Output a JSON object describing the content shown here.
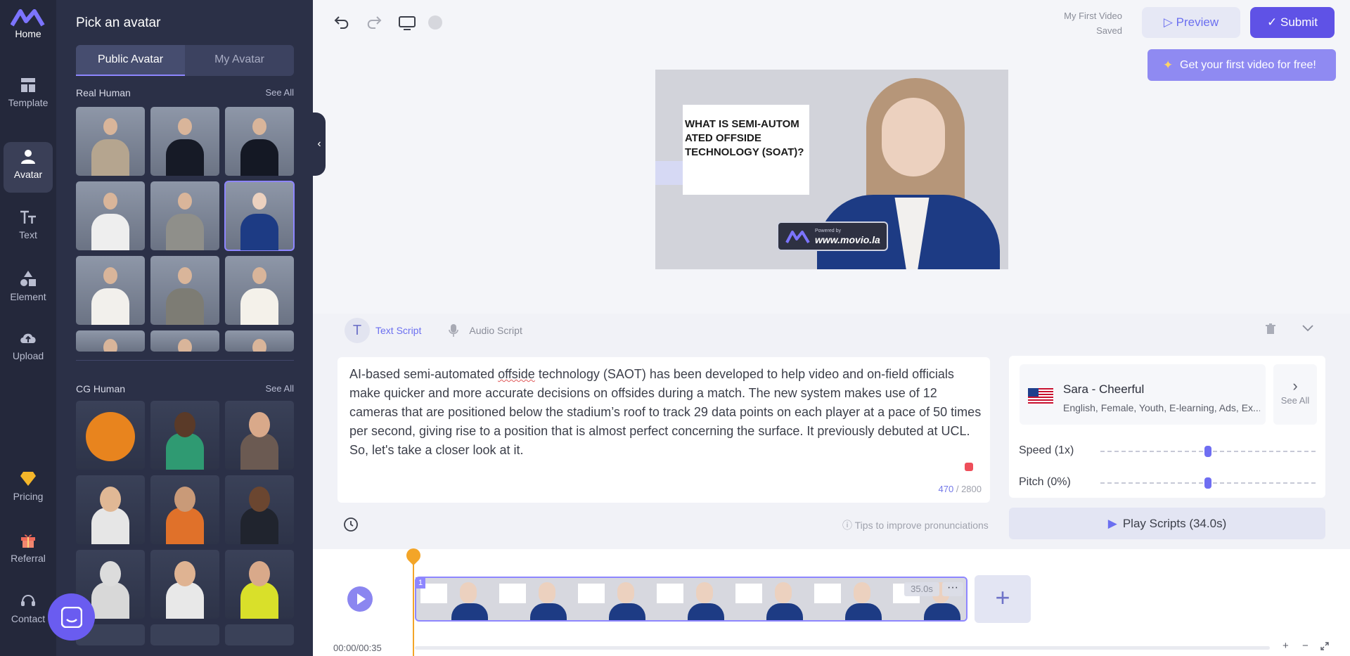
{
  "nav": {
    "home": "Home",
    "items": [
      {
        "label": "Template",
        "icon": "template-icon"
      },
      {
        "label": "Avatar",
        "icon": "avatar-icon",
        "active": true
      },
      {
        "label": "Text",
        "icon": "text-icon"
      },
      {
        "label": "Element",
        "icon": "element-icon"
      },
      {
        "label": "Upload",
        "icon": "upload-icon"
      },
      {
        "label": "Pricing",
        "icon": "pricing-icon"
      },
      {
        "label": "Referral",
        "icon": "gift-icon"
      },
      {
        "label": "Contact",
        "icon": "contact-icon"
      }
    ]
  },
  "panel": {
    "title": "Pick an avatar",
    "tab_public": "Public Avatar",
    "tab_mine": "My Avatar",
    "real_human": "Real Human",
    "cg_human": "CG Human",
    "see_all": "See All"
  },
  "header": {
    "project": "My First Video",
    "status": "Saved",
    "preview": "Preview",
    "submit": "Submit",
    "promo": "Get your first video for free!"
  },
  "canvas": {
    "heading": "WHAT IS SEMI-AUTOM ATED OFFSIDE TECHNOLOGY (SOAT)?",
    "watermark_sub": "Powered by",
    "watermark_url": "www.movio.la"
  },
  "script": {
    "tab_text": "Text Script",
    "tab_audio": "Audio Script",
    "body_before": "AI-based semi-automated ",
    "body_flag": "offside",
    "body_after": " technology (SAOT) has been developed to help video and on-field officials make quicker and more accurate decisions on offsides during a match. The new system makes use of 12 cameras that are positioned below the stadium’s roof to track 29 data points on each player at a pace of 50 times per second, giving rise to a position that is almost perfect concerning the surface. It previously debuted at UCL. So, let's take a closer look at it.",
    "count_used": "470",
    "count_max": "/ 2800",
    "tips": "Tips to improve pronunciations"
  },
  "voice": {
    "name": "Sara - Cheerful",
    "tags": "English, Female, Youth, E-learning, Ads, Ex...",
    "see_all": "See All",
    "speed_label": "Speed (1x)",
    "speed_level": 0.5,
    "pitch_label": "Pitch (0%)",
    "pitch_level": 0.5,
    "play": "Play Scripts (34.0s)"
  },
  "timeline": {
    "time": "00:00/00:35",
    "clip_index": "1",
    "clip_duration": "35.0s",
    "more": "···",
    "zoom_in": "+",
    "zoom_out": "−"
  },
  "colors": {
    "accent": "#5f52e6",
    "panel_bg": "#2b3047",
    "nav_bg": "#24283b",
    "playhead": "#f3a528"
  }
}
